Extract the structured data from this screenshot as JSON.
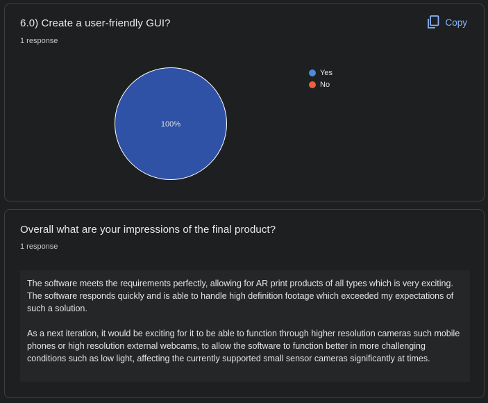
{
  "question1": {
    "title": "6.0) Create a user-friendly GUI?",
    "count": "1 response",
    "copy_label": "Copy",
    "chart_data": {
      "type": "pie",
      "categories": [
        "Yes",
        "No"
      ],
      "values": [
        100,
        0
      ],
      "colors": [
        "#2f52a6",
        "#e8603c"
      ],
      "slice_labels": [
        "100%",
        ""
      ],
      "legend": [
        {
          "label": "Yes",
          "color": "#4f8bd9"
        },
        {
          "label": "No",
          "color": "#e8603c"
        }
      ],
      "legend_position": "right"
    }
  },
  "question2": {
    "title": "Overall what are your impressions of the final product?",
    "count": "1 response",
    "response_paragraphs": [
      "The software meets the requirements perfectly, allowing for AR print products of all types which is very exciting. The software responds quickly and is able to handle high definition footage which exceeded my expectations of such a solution.",
      "As a next iteration, it would be exciting for it to be able to function through higher resolution cameras such mobile phones or high resolution external webcams, to allow the software to function better in more challenging conditions such as low light, affecting the currently supported small sensor cameras significantly at times."
    ]
  },
  "colors": {
    "background": "#1e1f20",
    "card_border": "#3c4043",
    "accent": "#8ab4f8",
    "response_bg": "#242628"
  }
}
